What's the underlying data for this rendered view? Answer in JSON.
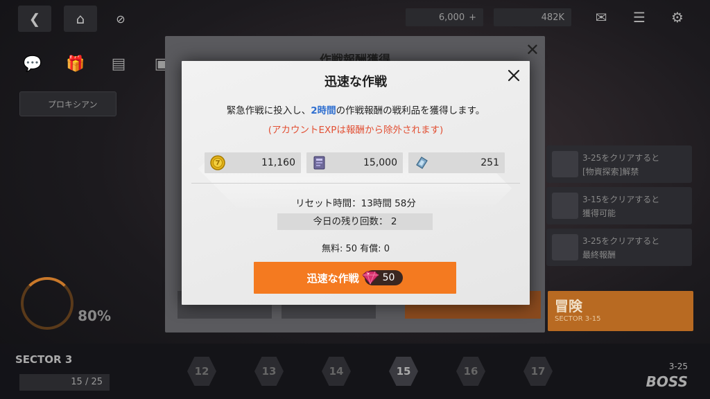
{
  "topbar": {
    "back_icon": "chevron-left-icon",
    "home_icon": "home-icon",
    "ticket_value": "6,000",
    "ticket_plus": "+",
    "coin_value": "482K",
    "mail_icon": "mail-icon",
    "menu_icon": "menu-icon",
    "settings_icon": "gear-icon"
  },
  "background": {
    "proxy_label": "プロキシアン",
    "dialog_title": "作戦報酬獲得",
    "side_items": [
      {
        "line1": "3-25をクリアすると",
        "line2": "[物資探索]解禁"
      },
      {
        "line1": "3-15をクリアすると",
        "line2": "獲得可能"
      },
      {
        "line1": "3-25をクリアすると",
        "line2": "最終報酬"
      }
    ],
    "progress_pct": "80%",
    "adventure_label": "冒険",
    "adventure_sub": "SECTOR 3-15",
    "sector_label": "SECTOR  3",
    "sector_count": "15 / 25",
    "stages": [
      "12",
      "13",
      "14",
      "15",
      "16",
      "17"
    ],
    "current_stage": "15",
    "boss_stage": "3-25",
    "boss_label": "BOSS"
  },
  "modal": {
    "title": "迅速な作戦",
    "desc_before": "緊急作戦に投入し、",
    "desc_highlight": "2時間",
    "desc_after": "の作戦報酬の戦利品を獲得します。",
    "note": "(アカウントEXPは報酬から除外されます)",
    "rewards": [
      {
        "icon": "gold-coin-icon",
        "value": "11,160"
      },
      {
        "icon": "data-chip-icon",
        "value": "15,000"
      },
      {
        "icon": "core-dust-icon",
        "value": "251"
      }
    ],
    "reset_time": "リセット時間：13時間 58分",
    "remaining": "今日の残り回数： 2",
    "free_paid": "無料: 50 有償: 0",
    "confirm_label": "迅速な作戦",
    "cost_icon": "gem-icon",
    "cost_value": "50"
  },
  "colors": {
    "accent_orange": "#f47a20",
    "highlight_blue": "#2f6fd0",
    "note_red": "#e25034"
  }
}
